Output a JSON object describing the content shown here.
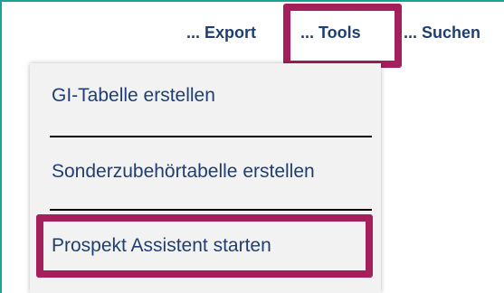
{
  "menu": {
    "export_label": "... Export",
    "tools_label": "... Tools",
    "suchen_label": "... Suchen"
  },
  "dropdown": {
    "items": [
      {
        "label": "GI-Tabelle erstellen"
      },
      {
        "label": "Sonderzubehörtabelle erstellen"
      },
      {
        "label": "Prospekt Assistent starten"
      }
    ]
  },
  "colors": {
    "border_teal": "#15a39a",
    "highlight": "#a41f5b",
    "text_blue": "#1f3f73",
    "menu_bg": "#f2f2f2"
  }
}
